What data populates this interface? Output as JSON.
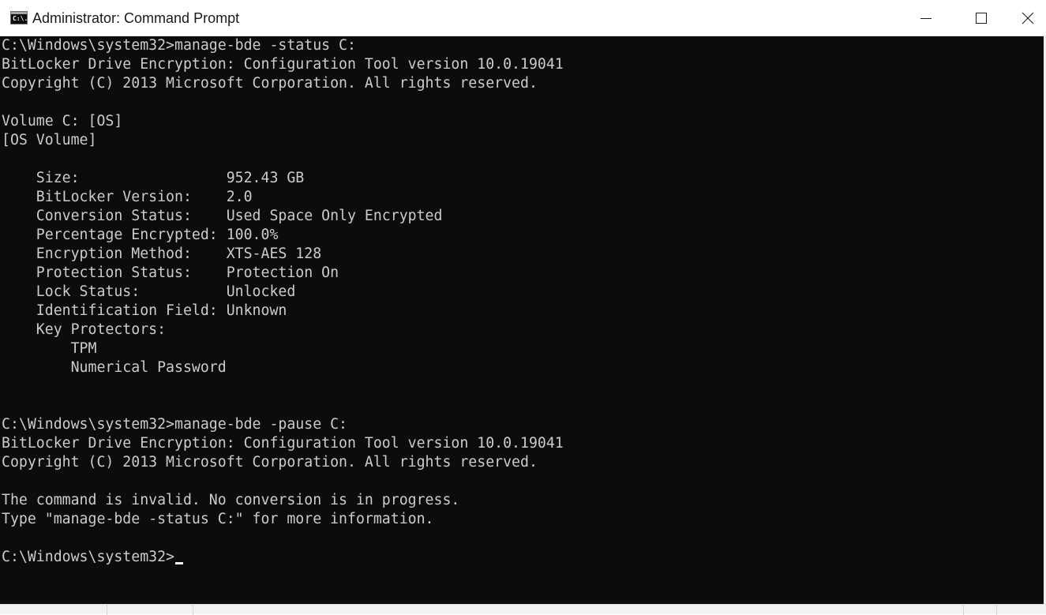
{
  "window": {
    "title": "Administrator: Command Prompt",
    "icon": "cmd-icon",
    "icon_glyph": "C:\\.",
    "controls": {
      "minimize": "minimize-icon",
      "maximize": "maximize-icon",
      "close": "close-icon"
    }
  },
  "colors": {
    "terminal_bg": "#0c0c0c",
    "terminal_fg": "#cccccc"
  },
  "console": {
    "lines": [
      "C:\\Windows\\system32>manage-bde -status C:",
      "BitLocker Drive Encryption: Configuration Tool version 10.0.19041",
      "Copyright (C) 2013 Microsoft Corporation. All rights reserved.",
      "",
      "Volume C: [OS]",
      "[OS Volume]",
      "",
      "    Size:                 952.43 GB",
      "    BitLocker Version:    2.0",
      "    Conversion Status:    Used Space Only Encrypted",
      "    Percentage Encrypted: 100.0%",
      "    Encryption Method:    XTS-AES 128",
      "    Protection Status:    Protection On",
      "    Lock Status:          Unlocked",
      "    Identification Field: Unknown",
      "    Key Protectors:",
      "        TPM",
      "        Numerical Password",
      "",
      "",
      "C:\\Windows\\system32>manage-bde -pause C:",
      "BitLocker Drive Encryption: Configuration Tool version 10.0.19041",
      "Copyright (C) 2013 Microsoft Corporation. All rights reserved.",
      "",
      "The command is invalid. No conversion is in progress.",
      "Type \"manage-bde -status C:\" for more information.",
      "",
      "C:\\Windows\\system32>"
    ]
  }
}
